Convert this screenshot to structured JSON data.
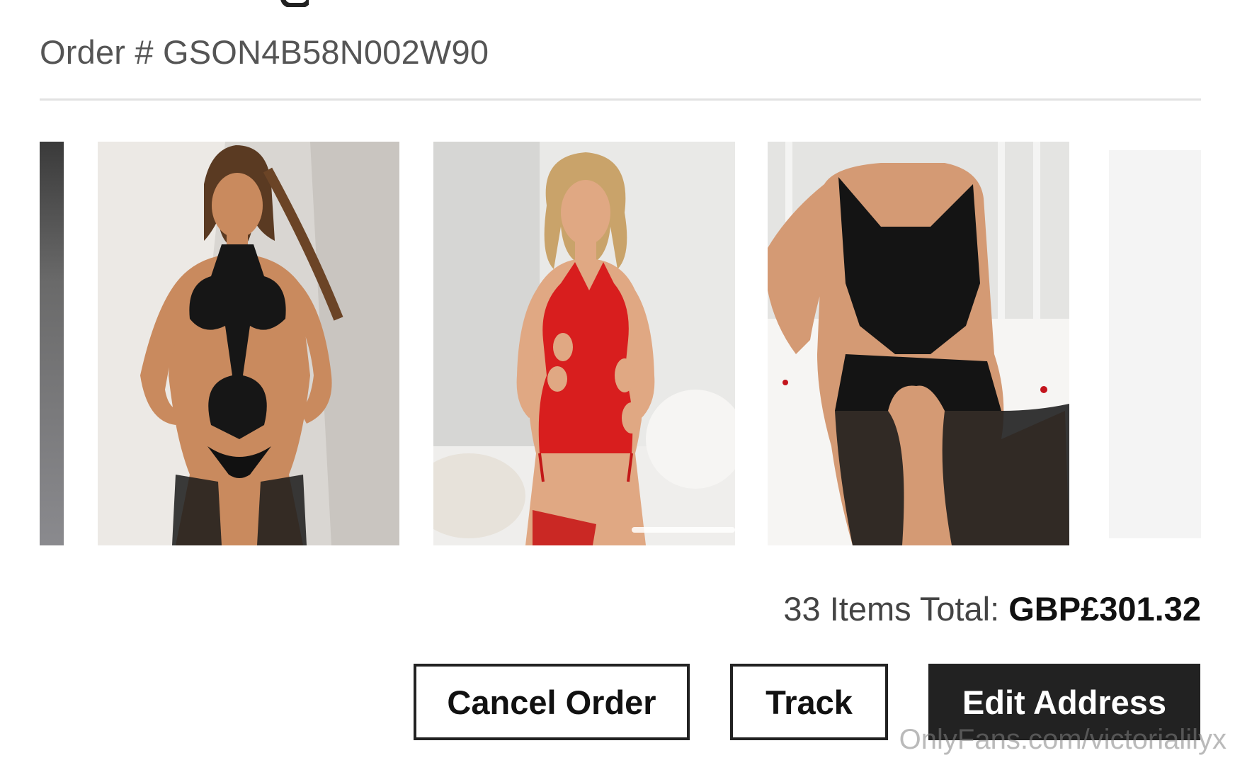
{
  "order": {
    "number_label": "Order # GSON4B58N002W90"
  },
  "carousel": {
    "items": [
      {
        "name": "black lace halter teddy with garters",
        "palette": {
          "bg": "#d9d6d2",
          "outfit": "#161616",
          "skin": "#c98a5e"
        }
      },
      {
        "name": "red faux leather cutout dress with garters",
        "palette": {
          "bg": "#e9e9e7",
          "outfit": "#d81e1e",
          "skin": "#e0a883"
        }
      },
      {
        "name": "black fishnet bodystocking",
        "palette": {
          "bg": "#f1f0ee",
          "outfit": "#141414",
          "skin": "#d49a74"
        }
      }
    ]
  },
  "summary": {
    "items_total_label": "33 Items Total:",
    "amount": "GBP£301.32"
  },
  "actions": {
    "cancel_label": "Cancel Order",
    "track_label": "Track",
    "edit_address_label": "Edit Address"
  },
  "watermark": {
    "text": "OnlyFans.com/victorialilyx"
  },
  "colors": {
    "primary_button": "#222222",
    "text_muted": "#555555",
    "divider": "#e2e2e2"
  }
}
